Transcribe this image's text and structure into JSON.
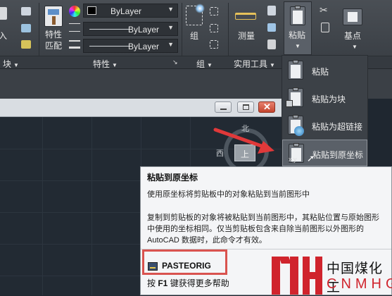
{
  "ribbon": {
    "left_partial_label": "入",
    "block_panel_label": "块",
    "match_props_label_1": "特性",
    "match_props_label_2": "匹配",
    "properties_panel_label": "特性",
    "color_dropdown": "ByLayer",
    "linetype_dropdown": "ByLayer",
    "lineweight_dropdown": "ByLayer",
    "group_label": "组",
    "group_panel_label": "组",
    "measure_label": "测量",
    "utilities_panel_label": "实用工具",
    "paste_label": "粘贴",
    "basepoint_label": "基点"
  },
  "paste_menu": {
    "items": [
      {
        "label": "粘贴"
      },
      {
        "label": "粘贴为块"
      },
      {
        "label": "粘贴为超链接"
      },
      {
        "label": "粘贴到原坐标"
      }
    ]
  },
  "viewcube": {
    "north": "北",
    "west": "西",
    "top": "上"
  },
  "tooltip": {
    "title": "粘贴到原坐标",
    "description": "使用原坐标将剪贴板中的对象粘贴到当前图形中",
    "paragraph": "复制到剪贴板的对象将被粘贴到当前图形中，其粘贴位置与原始图形中使用的坐标相同。仅当剪贴板包含来自除当前图形以外图形的 AutoCAD 数据时，此命令才有效。",
    "command": "PASTEORIG",
    "help_prefix": "按 ",
    "help_key": "F1",
    "help_suffix": " 键获得更多帮助"
  },
  "watermark": {
    "cn": "中国煤化工",
    "en": "CNMHG"
  },
  "colors": {
    "ribbon_bg": "#42474d",
    "canvas_bg": "#222a33",
    "highlight_red": "#d9534f",
    "arrow_red": "#e0393a"
  }
}
